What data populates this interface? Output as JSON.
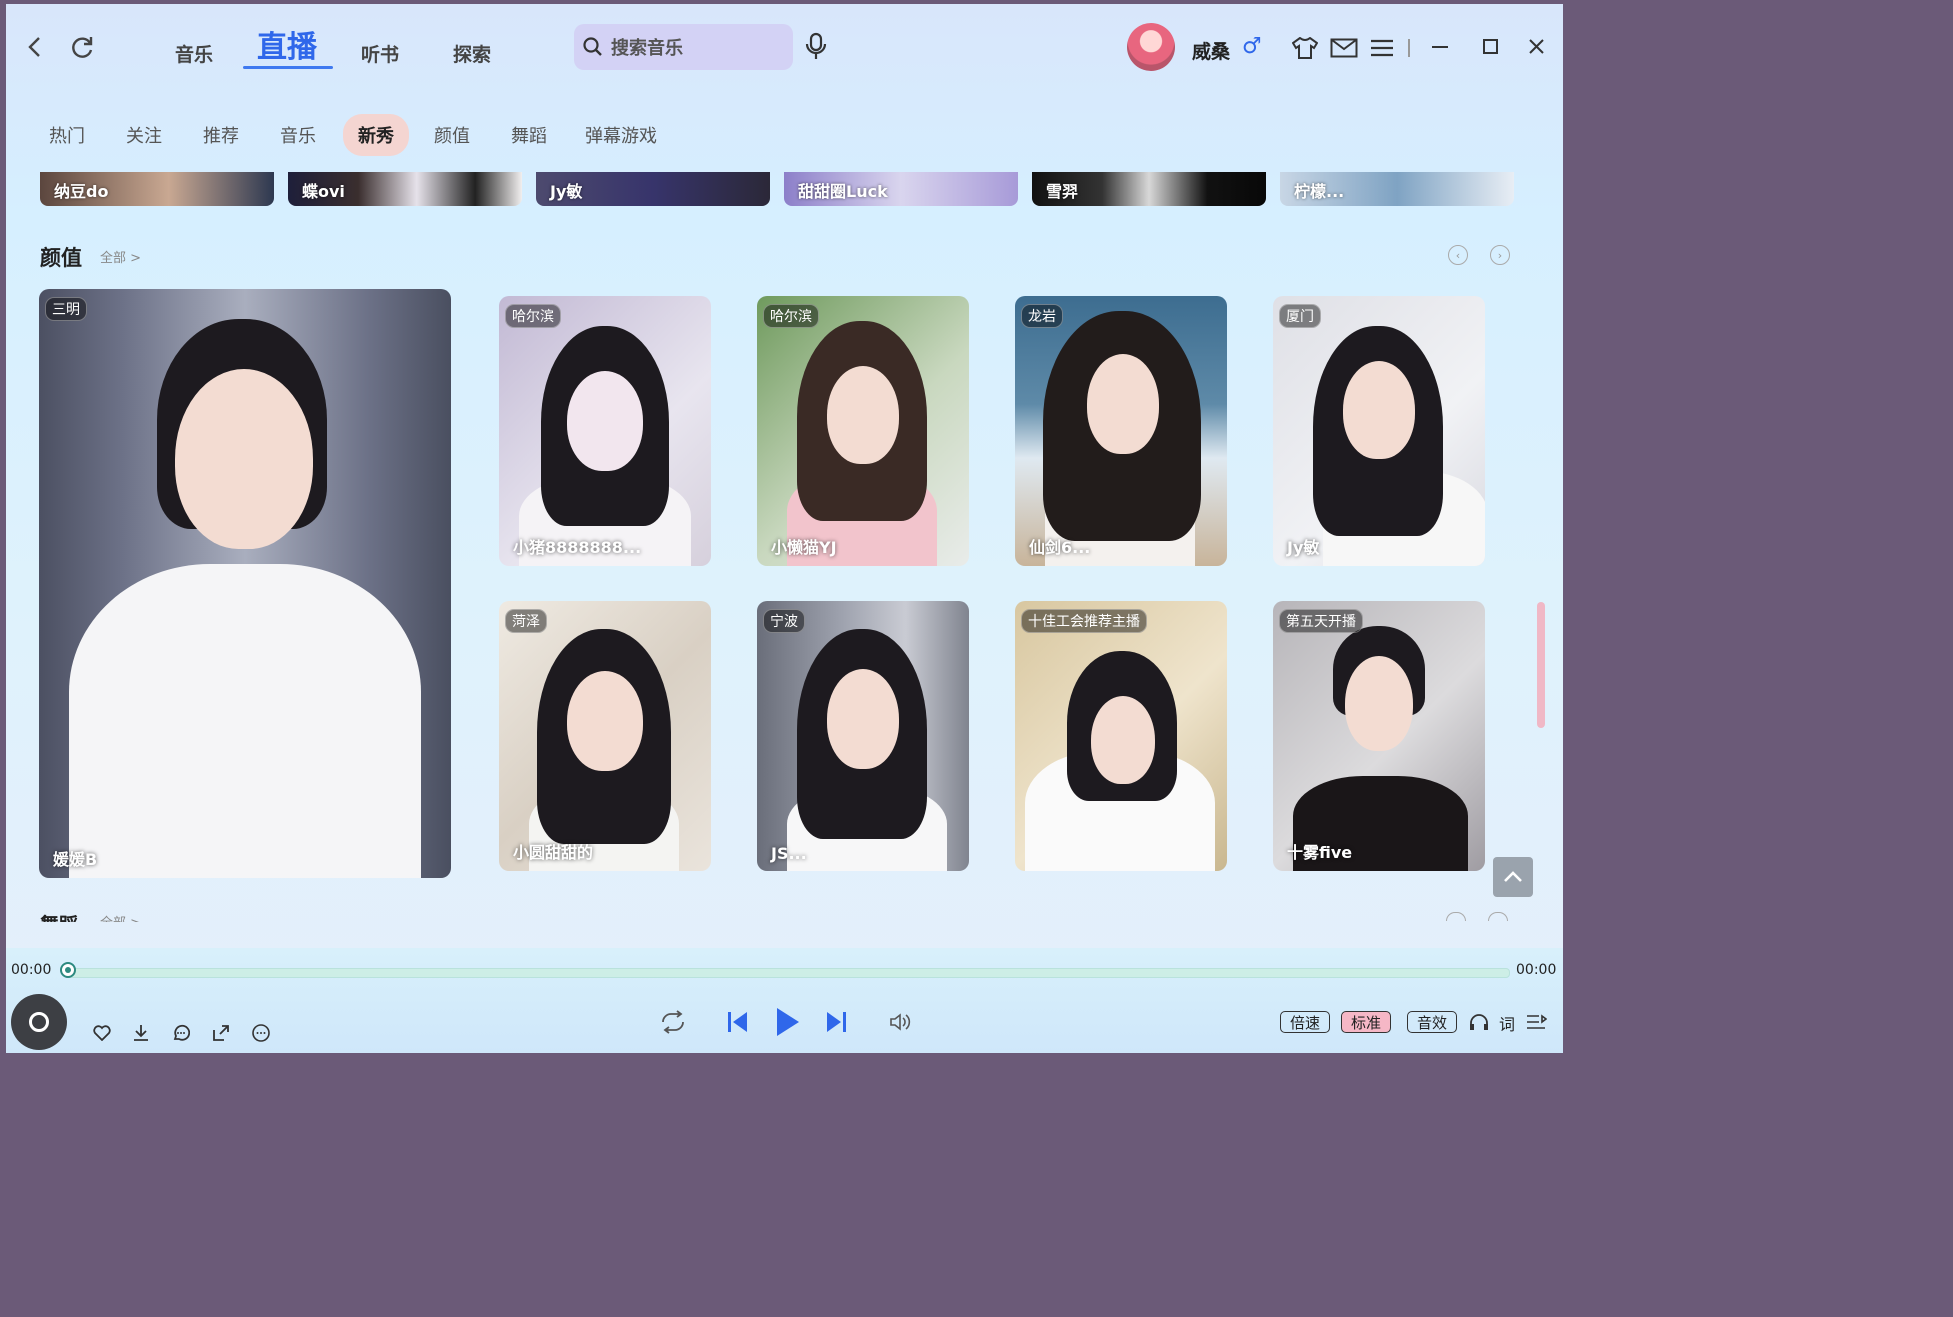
{
  "nav": {
    "tabs": [
      "音乐",
      "直播",
      "听书",
      "探索"
    ],
    "search_placeholder": "搜索音乐",
    "user_name": "威桑",
    "gender_symbol": "♂"
  },
  "categories": [
    "热门",
    "关注",
    "推荐",
    "音乐",
    "新秀",
    "颜值",
    "舞蹈",
    "弹幕游戏"
  ],
  "strip_items": [
    "纳豆do",
    "蝶ovi",
    "Jy敏",
    "甜甜圈Luck",
    "雪羿",
    "柠檬..."
  ],
  "section_yanzhi": {
    "title": "颜值",
    "more": "全部 >",
    "cards": [
      {
        "city": "三明",
        "name": "媛媛B"
      },
      {
        "city": "哈尔滨",
        "name": "小猪8888888..."
      },
      {
        "city": "哈尔滨",
        "name": "小懒猫YJ"
      },
      {
        "city": "龙岩",
        "name": "仙剑6..."
      },
      {
        "city": "厦门",
        "name": "Jy敏"
      },
      {
        "city": "菏泽",
        "name": "小圆甜甜的"
      },
      {
        "city": "宁波",
        "name": "JS..."
      },
      {
        "city": "十佳工会推荐主播",
        "name": ""
      },
      {
        "city": "第五天开播",
        "name": "十雾five"
      }
    ]
  },
  "section_wudao": {
    "title": "舞蹈",
    "more": "全部 >"
  },
  "player": {
    "time_current": "00:00",
    "time_total": "00:00",
    "progress": 0,
    "speed_label": "倍速",
    "quality_label": "标准",
    "effect_label": "音效",
    "lyrics_label": "词"
  },
  "colors": {
    "accent": "#2f67ea",
    "active_pill": "#f5b7c6",
    "category_active": "#f4d5d1"
  }
}
